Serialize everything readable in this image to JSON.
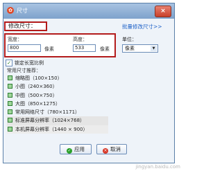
{
  "window": {
    "title": "尺寸",
    "close_symbol": "×"
  },
  "section": {
    "title": "修改尺寸：",
    "batch_link": "批量修改尺寸>>"
  },
  "size": {
    "width_label": "宽度：",
    "width_value": "800",
    "width_unit": "像素",
    "height_label": "高度：",
    "height_value": "533",
    "height_unit": "像素"
  },
  "unit": {
    "label": "单位：",
    "selected": "像素"
  },
  "lock_ratio": {
    "label": "锁定长宽比例",
    "checked": true
  },
  "presets": {
    "label": "常用尺寸推荐：",
    "items": [
      {
        "label": "缩略图（100×150）"
      },
      {
        "label": "小图（240×360）"
      },
      {
        "label": "中图（500×750）"
      },
      {
        "label": "大图（850×1275）"
      },
      {
        "label": "常用网络尺寸（780×1171）"
      },
      {
        "label": "标准屏幕分辨率（1024×768）"
      },
      {
        "label": "本机屏幕分辨率（1440 × 900）"
      }
    ]
  },
  "buttons": {
    "ok": "应用",
    "cancel": "取消"
  },
  "watermark": "jingyan.baidu.com"
}
